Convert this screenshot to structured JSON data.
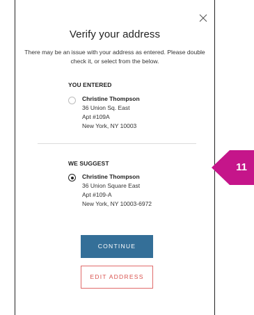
{
  "modal": {
    "title": "Verify your address",
    "subtitle": "There may be an issue with your address as entered. Please double check it, or select from the below."
  },
  "entered": {
    "label": "YOU ENTERED",
    "selected": false,
    "name": "Christine Thompson",
    "line1": "36 Union Sq. East",
    "line2": "Apt #109A",
    "line3": "New York, NY 10003"
  },
  "suggested": {
    "label": "WE SUGGEST",
    "selected": true,
    "name": "Christine Thompson",
    "line1": "36 Union Square East",
    "line2": "Apt #109-A",
    "line3": "New York, NY 10003-6972"
  },
  "buttons": {
    "continue_label": "CONTINUE",
    "edit_label": "EDIT ADDRESS"
  },
  "annotation": {
    "number": "11"
  },
  "colors": {
    "primary_button": "#346f98",
    "edit_button": "#d9534f",
    "callout": "#c5158a"
  },
  "icons": {
    "close": "close-icon"
  }
}
